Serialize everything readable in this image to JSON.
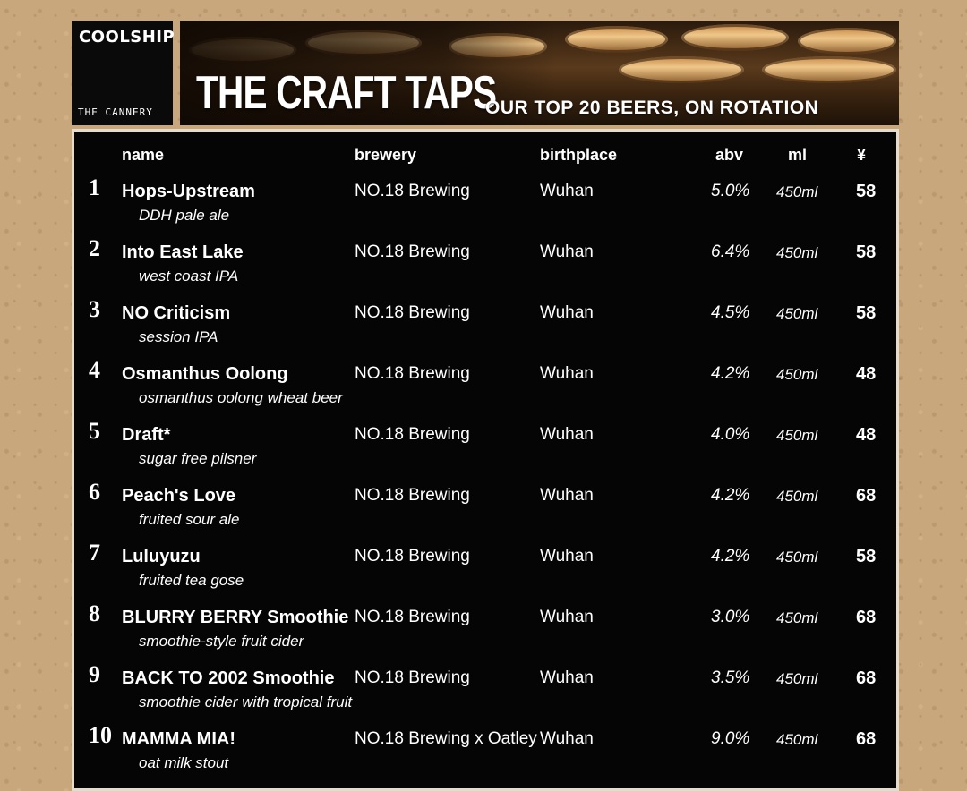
{
  "header": {
    "logo_main": "COOLSHIP",
    "logo_sub": "THE CANNERY",
    "title": "THE CRAFT TAPS",
    "subtitle": "OUR TOP 20 BEERS, ON ROTATION"
  },
  "columns": {
    "name": "name",
    "brewery": "brewery",
    "birthplace": "birthplace",
    "abv": "abv",
    "ml": "ml",
    "price": "¥"
  },
  "beers": [
    {
      "num": "1",
      "name": "Hops-Upstream",
      "style": "DDH pale ale",
      "brewery": "NO.18 Brewing",
      "birthplace": "Wuhan",
      "abv": "5.0%",
      "ml": "450ml",
      "price": "58"
    },
    {
      "num": "2",
      "name": "Into East Lake",
      "style": "west coast IPA",
      "brewery": "NO.18 Brewing",
      "birthplace": "Wuhan",
      "abv": "6.4%",
      "ml": "450ml",
      "price": "58"
    },
    {
      "num": "3",
      "name": "NO Criticism",
      "style": "session IPA",
      "brewery": "NO.18 Brewing",
      "birthplace": "Wuhan",
      "abv": "4.5%",
      "ml": "450ml",
      "price": "58"
    },
    {
      "num": "4",
      "name": "Osmanthus Oolong",
      "style": "osmanthus oolong wheat beer",
      "brewery": "NO.18 Brewing",
      "birthplace": "Wuhan",
      "abv": "4.2%",
      "ml": "450ml",
      "price": "48"
    },
    {
      "num": "5",
      "name": "Draft*",
      "style": "sugar free pilsner",
      "brewery": "NO.18 Brewing",
      "birthplace": "Wuhan",
      "abv": "4.0%",
      "ml": "450ml",
      "price": "48"
    },
    {
      "num": "6",
      "name": "Peach's Love",
      "style": "fruited sour ale",
      "brewery": "NO.18 Brewing",
      "birthplace": "Wuhan",
      "abv": "4.2%",
      "ml": "450ml",
      "price": "68"
    },
    {
      "num": "7",
      "name": "Luluyuzu",
      "style": "fruited tea gose",
      "brewery": "NO.18 Brewing",
      "birthplace": "Wuhan",
      "abv": "4.2%",
      "ml": "450ml",
      "price": "58"
    },
    {
      "num": "8",
      "name": "BLURRY BERRY Smoothie",
      "style": "smoothie-style fruit cider",
      "brewery": "NO.18 Brewing",
      "birthplace": "Wuhan",
      "abv": "3.0%",
      "ml": "450ml",
      "price": "68"
    },
    {
      "num": "9",
      "name": "BACK TO 2002 Smoothie",
      "style": "smoothie cider with tropical fruit",
      "brewery": "NO.18 Brewing",
      "birthplace": "Wuhan",
      "abv": "3.5%",
      "ml": "450ml",
      "price": "68"
    },
    {
      "num": "10",
      "name": "MAMMA MIA!",
      "style": "oat milk stout",
      "brewery": "NO.18 Brewing x Oatley",
      "birthplace": "Wuhan",
      "abv": "9.0%",
      "ml": "450ml",
      "price": "68"
    }
  ]
}
